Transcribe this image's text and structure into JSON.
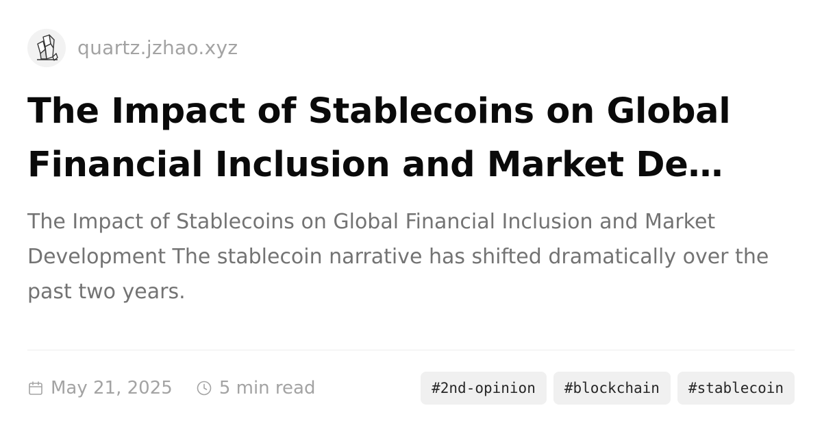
{
  "site": {
    "logo_icon": "quartz-crystal-icon",
    "name": "quartz.jzhao.xyz"
  },
  "article": {
    "title": "The Impact of Stablecoins on Global Financial Inclusion and Market De…",
    "description": "The Impact of Stablecoins on Global Financial Inclusion and Market Development The stablecoin narrative has shifted dramatically over the past two years."
  },
  "meta": {
    "date_icon": "calendar-icon",
    "date": "May 21, 2025",
    "reading_icon": "clock-icon",
    "reading_time": "5 min read"
  },
  "tags": [
    "#2nd-opinion",
    "#blockchain",
    "#stablecoin"
  ],
  "colors": {
    "title": "#0a0a0a",
    "muted": "#a3a3a3",
    "description": "#737373",
    "tag_bg": "#f0f0f0"
  }
}
